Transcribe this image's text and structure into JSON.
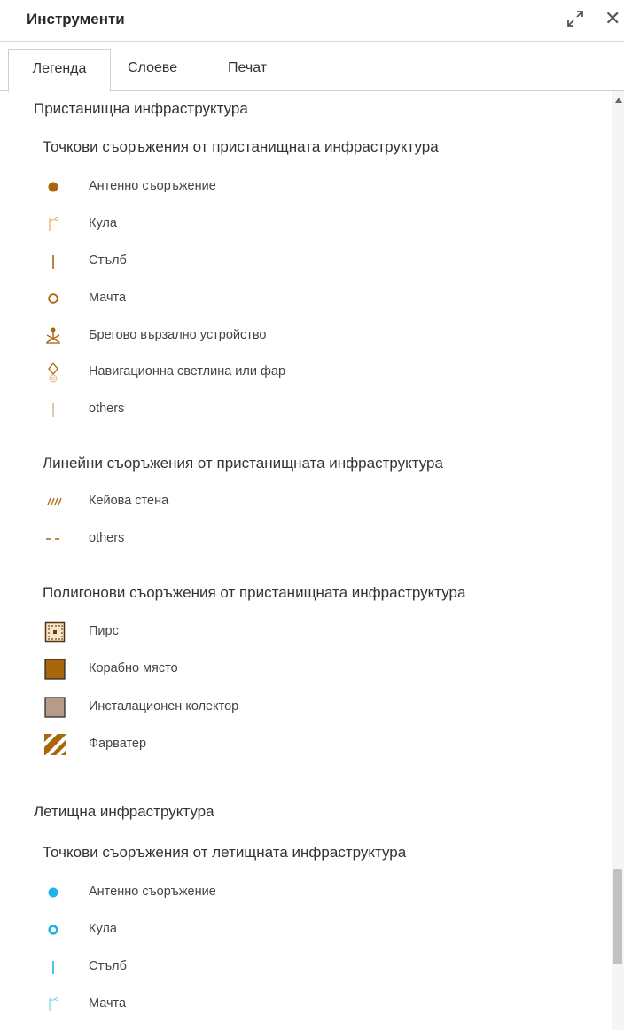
{
  "header": {
    "title": "Инструменти",
    "close_label": "✕"
  },
  "tabs": [
    {
      "label": "Легенда"
    },
    {
      "label": "Слоеве"
    },
    {
      "label": "Печат"
    }
  ],
  "legend": {
    "port": {
      "title": "Пристанищна инфраструктура",
      "point": {
        "title": "Точкови съоръжения от пристанищната инфраструктура",
        "items": [
          {
            "label": "Антенно съоръжение",
            "icon": "filled-circle-icon",
            "color": "#a8660d"
          },
          {
            "label": "Кула",
            "icon": "flag-icon",
            "color": "#a8660d"
          },
          {
            "label": "Стълб",
            "icon": "vertical-line-icon",
            "color": "#a8660d"
          },
          {
            "label": "Мачта",
            "icon": "ring-icon",
            "color": "#a8660d"
          },
          {
            "label": "Брегово вързално устройство",
            "icon": "bollard-icon",
            "color": "#a8660d"
          },
          {
            "label": "Навигационна светлина или фар",
            "icon": "lighthouse-icon",
            "color": "#a8660d"
          },
          {
            "label": "others",
            "icon": "vertical-line-icon",
            "color": "#a8660d"
          }
        ]
      },
      "line": {
        "title": "Линейни съоръжения от пристанищната инфраструктура",
        "items": [
          {
            "label": "Кейова стена",
            "icon": "hatched-line-icon",
            "color": "#a8660d"
          },
          {
            "label": "others",
            "icon": "dashed-line-icon",
            "color": "#a8660d"
          }
        ]
      },
      "polygon": {
        "title": "Полигонови съоръжения от пристанищната инфраструктура",
        "items": [
          {
            "label": "Пирс",
            "icon": "dotted-square-icon",
            "color": "#f5e6c8"
          },
          {
            "label": "Корабно място",
            "icon": "filled-square-icon",
            "color": "#a8660d"
          },
          {
            "label": "Инсталационен колектор",
            "icon": "filled-square-icon",
            "color": "#b59b88"
          },
          {
            "label": "Фарватер",
            "icon": "striped-square-icon",
            "color": "#a8660d"
          }
        ]
      }
    },
    "airport": {
      "title": "Летищна инфраструктура",
      "point": {
        "title": "Точкови съоръжения от летищната инфраструктура",
        "items": [
          {
            "label": "Антенно съоръжение",
            "icon": "filled-circle-icon",
            "color": "#1fb3e8"
          },
          {
            "label": "Кула",
            "icon": "ring-icon",
            "color": "#1fb3e8"
          },
          {
            "label": "Стълб",
            "icon": "vertical-line-icon",
            "color": "#1fb3e8"
          },
          {
            "label": "Мачта",
            "icon": "flag-icon",
            "color": "#1fb3e8"
          }
        ]
      }
    }
  }
}
